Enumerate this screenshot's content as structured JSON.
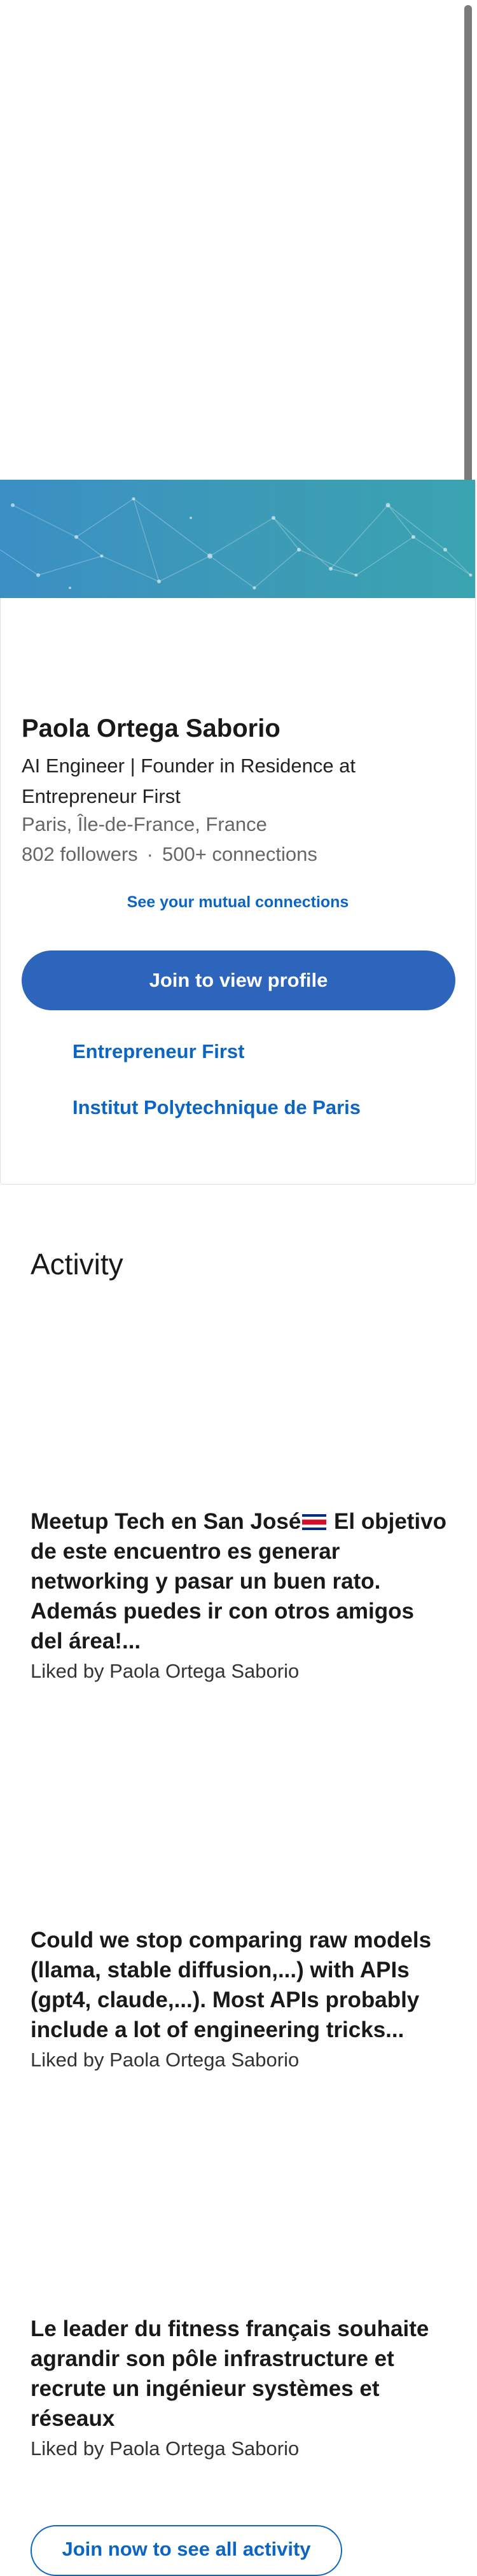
{
  "profile": {
    "name": "Paola Ortega Saborio",
    "headline": "AI Engineer | Founder in Residence at Entrepreneur First",
    "location": "Paris, Île-de-France, France",
    "followers": "802 followers",
    "separator": "·",
    "connections": "500+ connections",
    "mutual_link": "See your mutual connections",
    "join_button": "Join to view profile",
    "links": [
      "Entrepreneur First",
      "Institut Polytechnique de Paris"
    ]
  },
  "activity": {
    "title": "Activity",
    "posts": [
      {
        "text_before_flag": "Meetup Tech en San José",
        "flag_icon": "costa-rica-flag",
        "text_after_flag": " El objetivo de este encuentro es generar networking y pasar un buen rato. Además puedes ir con otros amigos del área!...",
        "liked_by": "Liked by Paola Ortega Saborio"
      },
      {
        "text": "Could we stop comparing raw models (llama, stable diffusion,...) with APIs (gpt4, claude,...). Most APIs probably include a lot of engineering tricks...",
        "liked_by": "Liked by Paola Ortega Saborio"
      },
      {
        "text": "Le leader du fitness français souhaite agrandir son pôle infrastructure et recrute un ingénieur systèmes et réseaux",
        "liked_by": "Liked by Paola Ortega Saborio"
      }
    ],
    "join_button": "Join now to see all activity"
  },
  "colors": {
    "accent": "#0a66c2",
    "button": "#2d64bc",
    "banner": "#3d9ab8"
  }
}
